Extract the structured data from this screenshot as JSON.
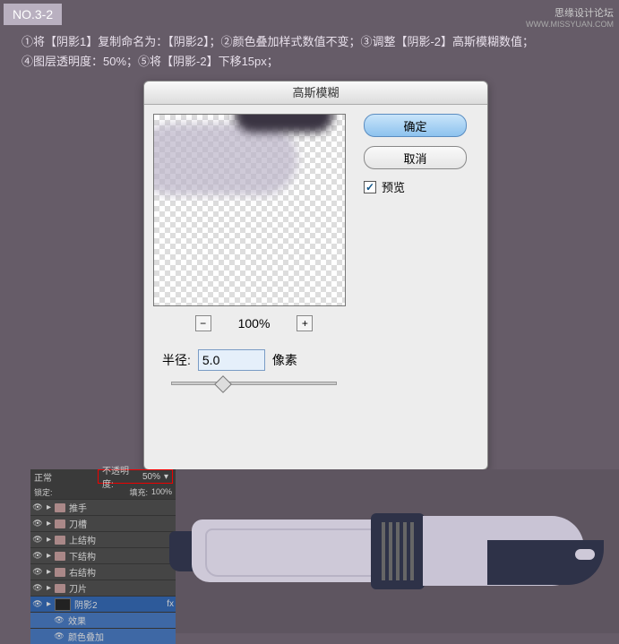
{
  "header": {
    "step_badge": "NO.3-2",
    "watermark_line1": "思缘设计论坛",
    "watermark_line2": "WWW.MISSYUAN.COM"
  },
  "instructions": {
    "line1": "①将【阴影1】复制命名为：【阴影2】；②颜色叠加样式数值不变；③调整【阴影-2】高斯模糊数值；",
    "line2": "④图层透明度：50%；⑤将【阴影-2】下移15px；"
  },
  "dialog": {
    "title": "高斯模糊",
    "ok_label": "确定",
    "cancel_label": "取消",
    "preview_label": "预览",
    "preview_checked": "✓",
    "zoom_out": "−",
    "zoom_in": "+",
    "zoom_value": "100%",
    "radius_label": "半径:",
    "radius_value": "5.0",
    "radius_unit": "像素"
  },
  "layers_panel": {
    "blend_mode": "正常",
    "opacity_label": "不透明度:",
    "opacity_value": "50%",
    "lock_label": "锁定:",
    "fill_label": "填充:",
    "fill_value": "100%",
    "layers": [
      {
        "name": "推手",
        "type": "folder"
      },
      {
        "name": "刀槽",
        "type": "folder"
      },
      {
        "name": "上结构",
        "type": "folder"
      },
      {
        "name": "下结构",
        "type": "folder"
      },
      {
        "name": "右结构",
        "type": "folder"
      },
      {
        "name": "刀片",
        "type": "folder"
      },
      {
        "name": "阴影2",
        "type": "layer",
        "selected": true,
        "fx": "fx"
      },
      {
        "name": "效果",
        "type": "sub"
      },
      {
        "name": "颜色叠加",
        "type": "sub"
      }
    ]
  }
}
